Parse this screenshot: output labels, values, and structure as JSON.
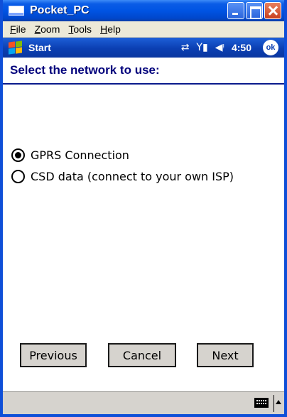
{
  "window": {
    "title": "Pocket_PC"
  },
  "menubar": {
    "items": [
      {
        "label": "File",
        "mnemonic": "F"
      },
      {
        "label": "Zoom",
        "mnemonic": "Z"
      },
      {
        "label": "Tools",
        "mnemonic": "T"
      },
      {
        "label": "Help",
        "mnemonic": "H"
      }
    ]
  },
  "taskbar": {
    "start_label": "Start",
    "clock": "4:50",
    "ok_label": "ok",
    "icons": [
      "connectivity-icon",
      "signal-icon",
      "speaker-icon"
    ]
  },
  "page": {
    "header": "Select the network to use:"
  },
  "options": [
    {
      "label": "GPRS Connection",
      "selected": true
    },
    {
      "label": "CSD data (connect to your own ISP)",
      "selected": false
    }
  ],
  "buttons": {
    "previous": "Previous",
    "cancel": "Cancel",
    "next": "Next"
  },
  "bottombar": {
    "icons": [
      "keyboard-icon",
      "up-arrow-icon"
    ]
  }
}
